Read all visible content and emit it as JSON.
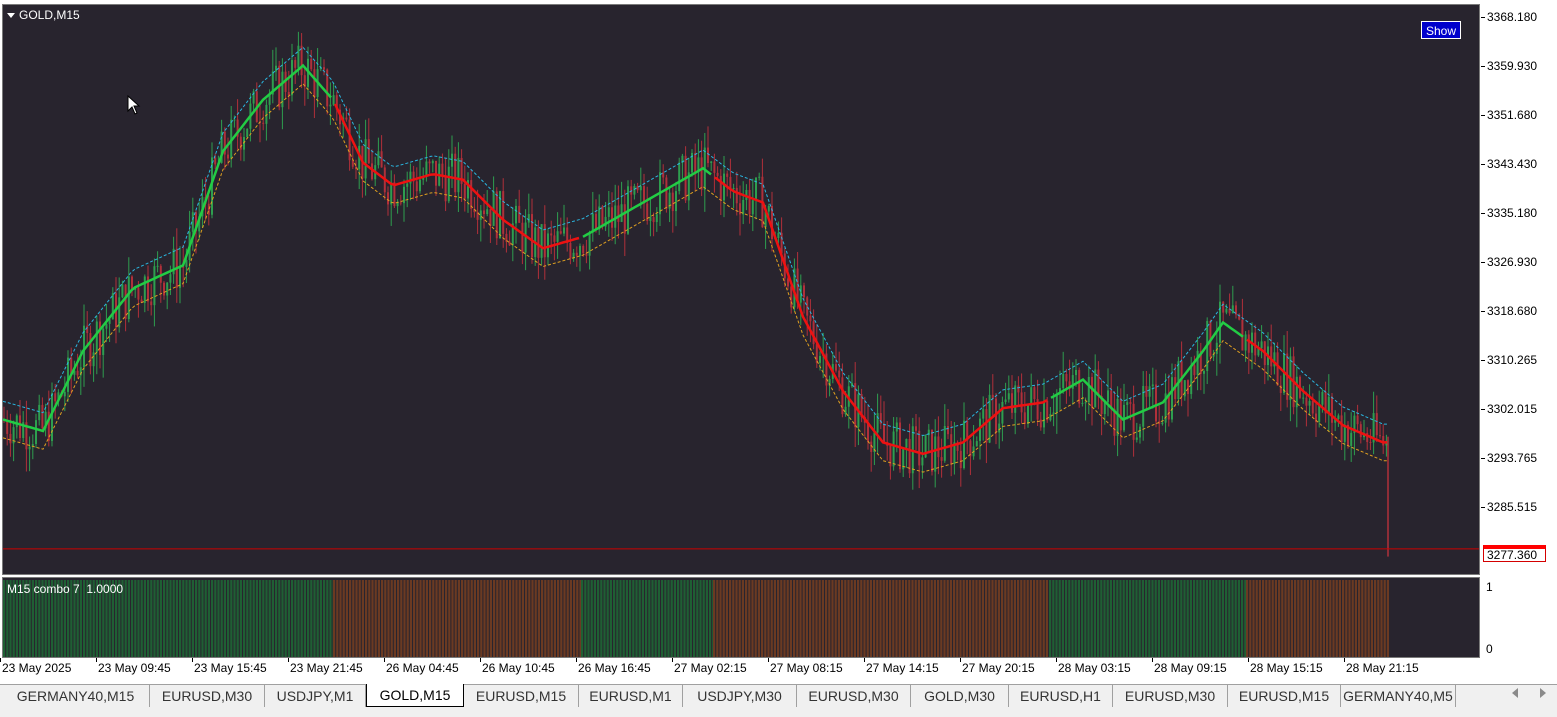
{
  "window": {
    "symbol_label": "GOLD,M15",
    "show_button_label": "Show"
  },
  "colors": {
    "chart_bg": "#28242e",
    "bull_candle": "#2e9e4f",
    "bear_candle": "#b0303a",
    "ma_up": "#22cc44",
    "ma_down": "#ee1111",
    "upper_band": "#2ab7e0",
    "lower_band": "#e0a020",
    "bar_green": "#1f5f34",
    "bar_brown": "#6b3a22",
    "current_price_line": "#cc0000"
  },
  "price_axis": {
    "labels": [
      "3368.180",
      "3359.930",
      "3351.680",
      "3343.430",
      "3335.180",
      "3326.930",
      "3318.680",
      "3310.265",
      "3302.015",
      "3293.765",
      "3285.515"
    ],
    "current_price": "3277.360"
  },
  "indicator": {
    "label": "M15 combo 7  1.0000",
    "axis_top": "1",
    "axis_bottom": "0"
  },
  "time_axis": {
    "labels": [
      "23 May 2025",
      "23 May 09:45",
      "23 May 15:45",
      "23 May 21:45",
      "26 May 04:45",
      "26 May 10:45",
      "26 May 16:45",
      "27 May 02:15",
      "27 May 08:15",
      "27 May 14:15",
      "27 May 20:15",
      "28 May 03:15",
      "28 May 09:15",
      "28 May 15:15",
      "28 May 21:15"
    ]
  },
  "tabs": [
    {
      "label": "GERMANY40,M15",
      "active": false
    },
    {
      "label": "EURUSD,M30",
      "active": false
    },
    {
      "label": "USDJPY,M1",
      "active": false
    },
    {
      "label": "GOLD,M15",
      "active": true
    },
    {
      "label": "EURUSD,M15",
      "active": false
    },
    {
      "label": "EURUSD,M1",
      "active": false
    },
    {
      "label": "USDJPY,M30",
      "active": false
    },
    {
      "label": "EURUSD,M30",
      "active": false
    },
    {
      "label": "GOLD,M30",
      "active": false
    },
    {
      "label": "EURUSD,H1",
      "active": false
    },
    {
      "label": "EURUSD,M30",
      "active": false
    },
    {
      "label": "EURUSD,M15",
      "active": false
    },
    {
      "label": "GERMANY40,M5",
      "active": false
    }
  ],
  "chart_data": {
    "type": "candlestick",
    "symbol": "GOLD",
    "timeframe": "M15",
    "ylim": [
      3274.0,
      3370.5
    ],
    "current_price": 3277.36,
    "trend_path": [
      [
        0,
        3300.0
      ],
      [
        40,
        3298.0
      ],
      [
        80,
        3312.0
      ],
      [
        130,
        3323.0
      ],
      [
        180,
        3327.0
      ],
      [
        220,
        3347.0
      ],
      [
        260,
        3356.0
      ],
      [
        300,
        3362.0
      ],
      [
        330,
        3356.0
      ],
      [
        360,
        3345.0
      ],
      [
        390,
        3341.0
      ],
      [
        430,
        3343.0
      ],
      [
        460,
        3342.0
      ],
      [
        500,
        3335.0
      ],
      [
        540,
        3330.0
      ],
      [
        580,
        3332.0
      ],
      [
        620,
        3336.0
      ],
      [
        660,
        3340.0
      ],
      [
        700,
        3344.0
      ],
      [
        730,
        3340.0
      ],
      [
        760,
        3338.0
      ],
      [
        800,
        3318.0
      ],
      [
        840,
        3305.0
      ],
      [
        880,
        3296.0
      ],
      [
        920,
        3294.0
      ],
      [
        960,
        3296.0
      ],
      [
        1000,
        3302.0
      ],
      [
        1040,
        3303.0
      ],
      [
        1080,
        3307.0
      ],
      [
        1120,
        3300.0
      ],
      [
        1160,
        3303.0
      ],
      [
        1200,
        3312.0
      ],
      [
        1220,
        3317.0
      ],
      [
        1260,
        3312.0
      ],
      [
        1300,
        3305.0
      ],
      [
        1340,
        3299.0
      ],
      [
        1380,
        3296.0
      ]
    ],
    "signal_segments": [
      {
        "from": 0,
        "to": 330,
        "state": "up"
      },
      {
        "from": 330,
        "to": 578,
        "state": "down"
      },
      {
        "from": 578,
        "to": 710,
        "state": "up"
      },
      {
        "from": 710,
        "to": 1046,
        "state": "down"
      },
      {
        "from": 1046,
        "to": 1243,
        "state": "up"
      },
      {
        "from": 1243,
        "to": 1386,
        "state": "down"
      }
    ],
    "series": [
      {
        "name": "M15 combo 7",
        "value": 1.0
      }
    ]
  }
}
